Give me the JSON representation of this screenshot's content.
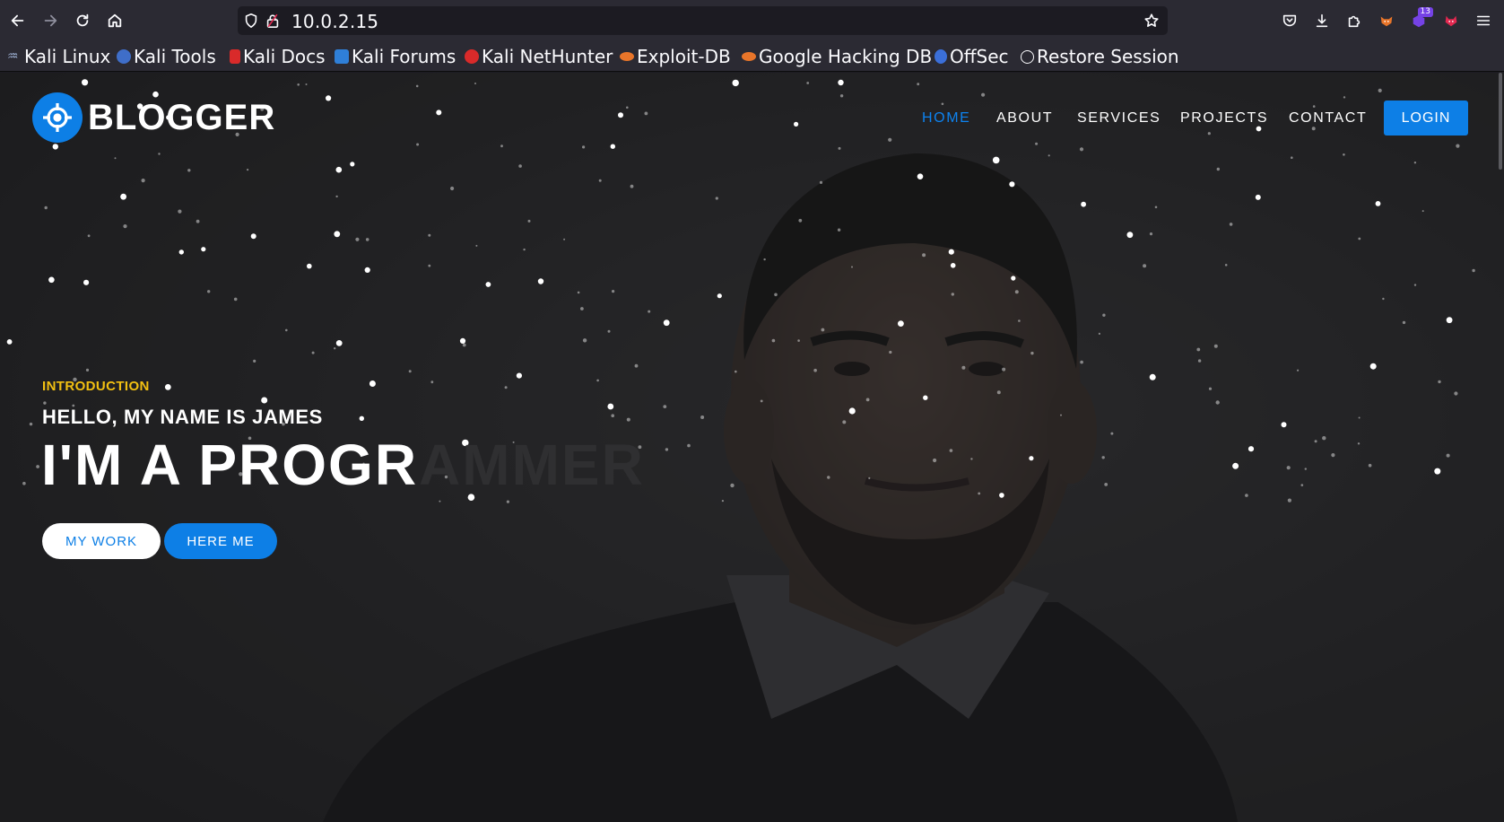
{
  "browser": {
    "url": "10.0.2.15",
    "extensions_badge": "13",
    "bookmarks": [
      {
        "label": "Kali Linux",
        "icon": "kali-dragon-icon"
      },
      {
        "label": "Kali Tools",
        "icon": "kali-tools-icon"
      },
      {
        "label": "Kali Docs",
        "icon": "kali-docs-icon"
      },
      {
        "label": "Kali Forums",
        "icon": "kali-forums-icon"
      },
      {
        "label": "Kali NetHunter",
        "icon": "nethunter-icon"
      },
      {
        "label": "Exploit-DB",
        "icon": "exploit-db-icon"
      },
      {
        "label": "Google Hacking DB",
        "icon": "ghdb-icon"
      },
      {
        "label": "OffSec",
        "icon": "offsec-icon"
      },
      {
        "label": "Restore Session",
        "icon": "globe-icon"
      }
    ]
  },
  "site": {
    "brand": "BLOGGER",
    "nav": {
      "home": "HOME",
      "about": "ABOUT",
      "services": "SERVICES",
      "projects": "PROJECTS",
      "contact": "CONTACT",
      "login": "LOGIN"
    },
    "hero": {
      "intro": "INTRODUCTION",
      "greeting": "HELLO, MY NAME IS JAMES",
      "headline_typed": "I'M A PROGR",
      "headline_rest": "AMMER",
      "work_button": "MY WORK",
      "hire_button": "HERE ME"
    }
  },
  "colors": {
    "accent": "#0d7fe6",
    "intro": "#f2c012",
    "chrome": "#2b2a33"
  }
}
